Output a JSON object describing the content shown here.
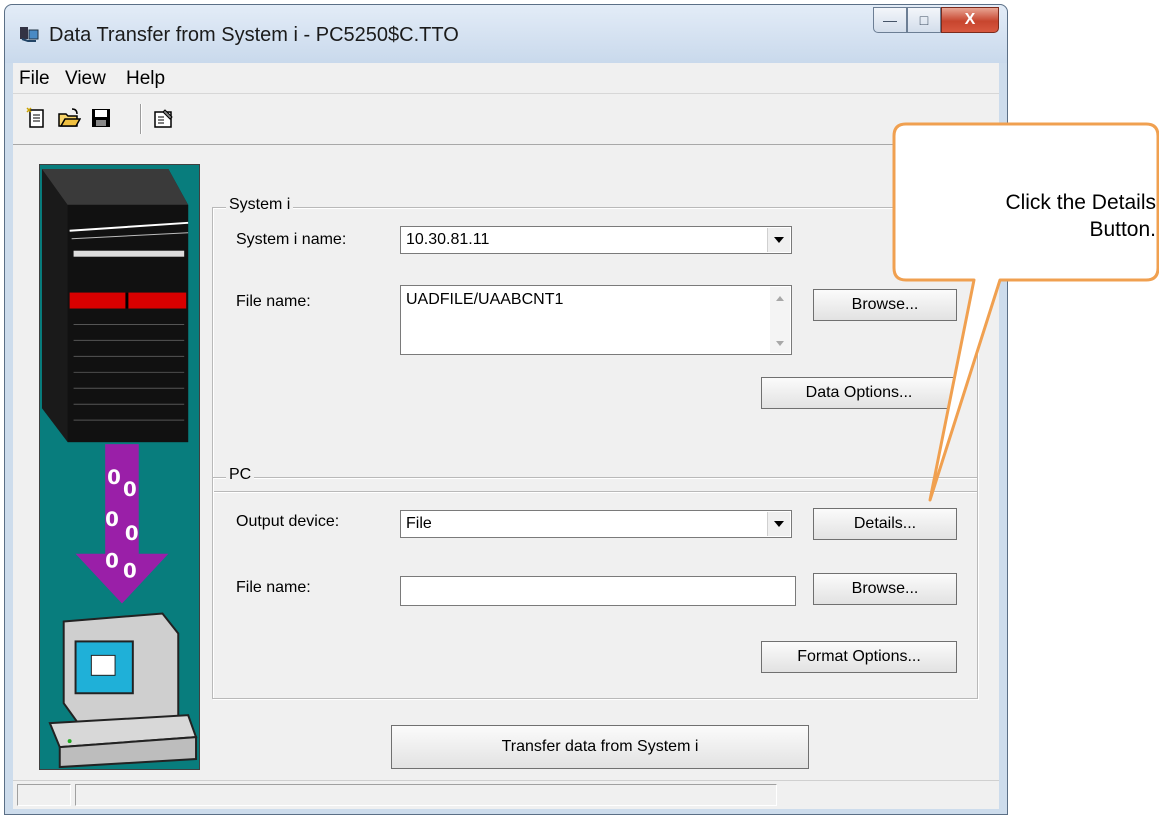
{
  "window": {
    "title": "Data Transfer from System i - PC5250$C.TTO",
    "caption_buttons": {
      "minimize": "—",
      "maximize": "□",
      "close": "X"
    }
  },
  "menu": {
    "items": [
      "File",
      "View",
      "Help"
    ]
  },
  "toolbar": {
    "icons": [
      "new-request-icon",
      "open-icon",
      "save-icon",
      "properties-icon"
    ]
  },
  "system_i": {
    "group_label": "System i",
    "name_label": "System i name:",
    "name_value": "10.30.81.11",
    "file_label": "File name:",
    "file_value": "UADFILE/UAABCNT1",
    "browse_button": "Browse...",
    "data_options_button": "Data Options..."
  },
  "pc": {
    "group_label": "PC",
    "output_label": "Output device:",
    "output_value": "File",
    "details_button": "Details...",
    "file_label": "File name:",
    "file_value": "",
    "browse_button": "Browse...",
    "format_options_button": "Format Options..."
  },
  "transfer_button": "Transfer data from System i",
  "callout": {
    "text": "Click the Details\nButton."
  },
  "colors": {
    "art_background": "#087d7d",
    "callout_fill": "#ffffff",
    "callout_border": "#f0a050",
    "arrow": "#9a1fa8"
  }
}
